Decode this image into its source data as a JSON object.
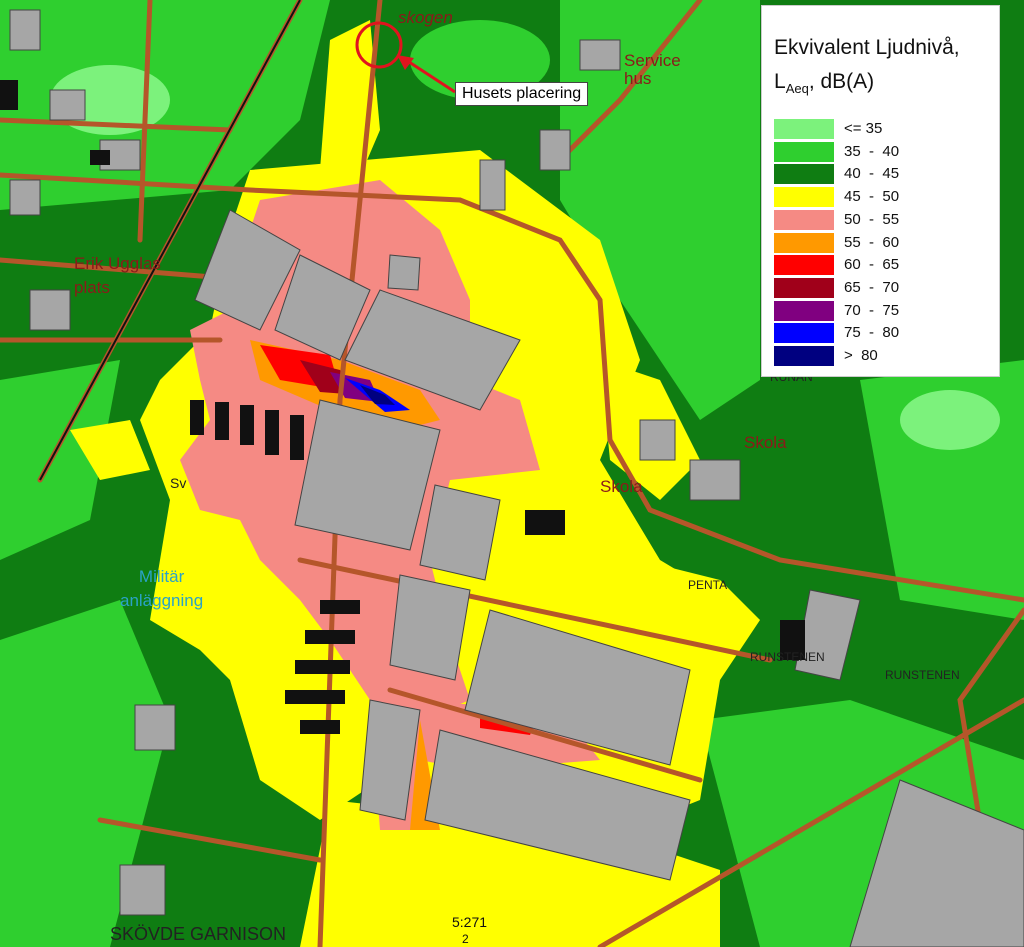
{
  "map": {
    "labels": {
      "skogen": "skogen",
      "service": "Service\nhus",
      "erik": "Erik Ugglas\nplats",
      "sv": "Sv",
      "militar": "Militär\nanläggning",
      "skola1": "Skola",
      "skola2": "Skola",
      "runan": "RUNAN",
      "penta": "PENTA",
      "runstenen1": "RUNSTENEN",
      "runstenen2": "RUNSTENEN",
      "garnison": "SKÖVDE GARNISON",
      "fastighet": "5:271",
      "fastighet2": "2"
    },
    "callout": "Husets placering",
    "colors": {
      "ring": "#e0141e",
      "road": "#b5562a",
      "building": "#a6a6a6",
      "black_building": "#111111"
    }
  },
  "legend": {
    "title_line1": "Ekvivalent Ljudnivå,",
    "title_L": "L",
    "title_sub": "Aeq",
    "title_rest": ", dB(A)",
    "items": [
      {
        "label": "<= 35",
        "color": "#7cf27c"
      },
      {
        "label": "35  -  40",
        "color": "#2fcf2f"
      },
      {
        "label": "40  -  45",
        "color": "#0f7d12"
      },
      {
        "label": "45  -  50",
        "color": "#ffff00"
      },
      {
        "label": "50  -  55",
        "color": "#f58a84"
      },
      {
        "label": "55  -  60",
        "color": "#ff9900"
      },
      {
        "label": "60  -  65",
        "color": "#ff0000"
      },
      {
        "label": "65  -  70",
        "color": "#a0001a"
      },
      {
        "label": "70  -  75",
        "color": "#800080"
      },
      {
        "label": "75  -  80",
        "color": "#0000ff"
      },
      {
        "label": ">  80",
        "color": "#000080"
      }
    ]
  }
}
